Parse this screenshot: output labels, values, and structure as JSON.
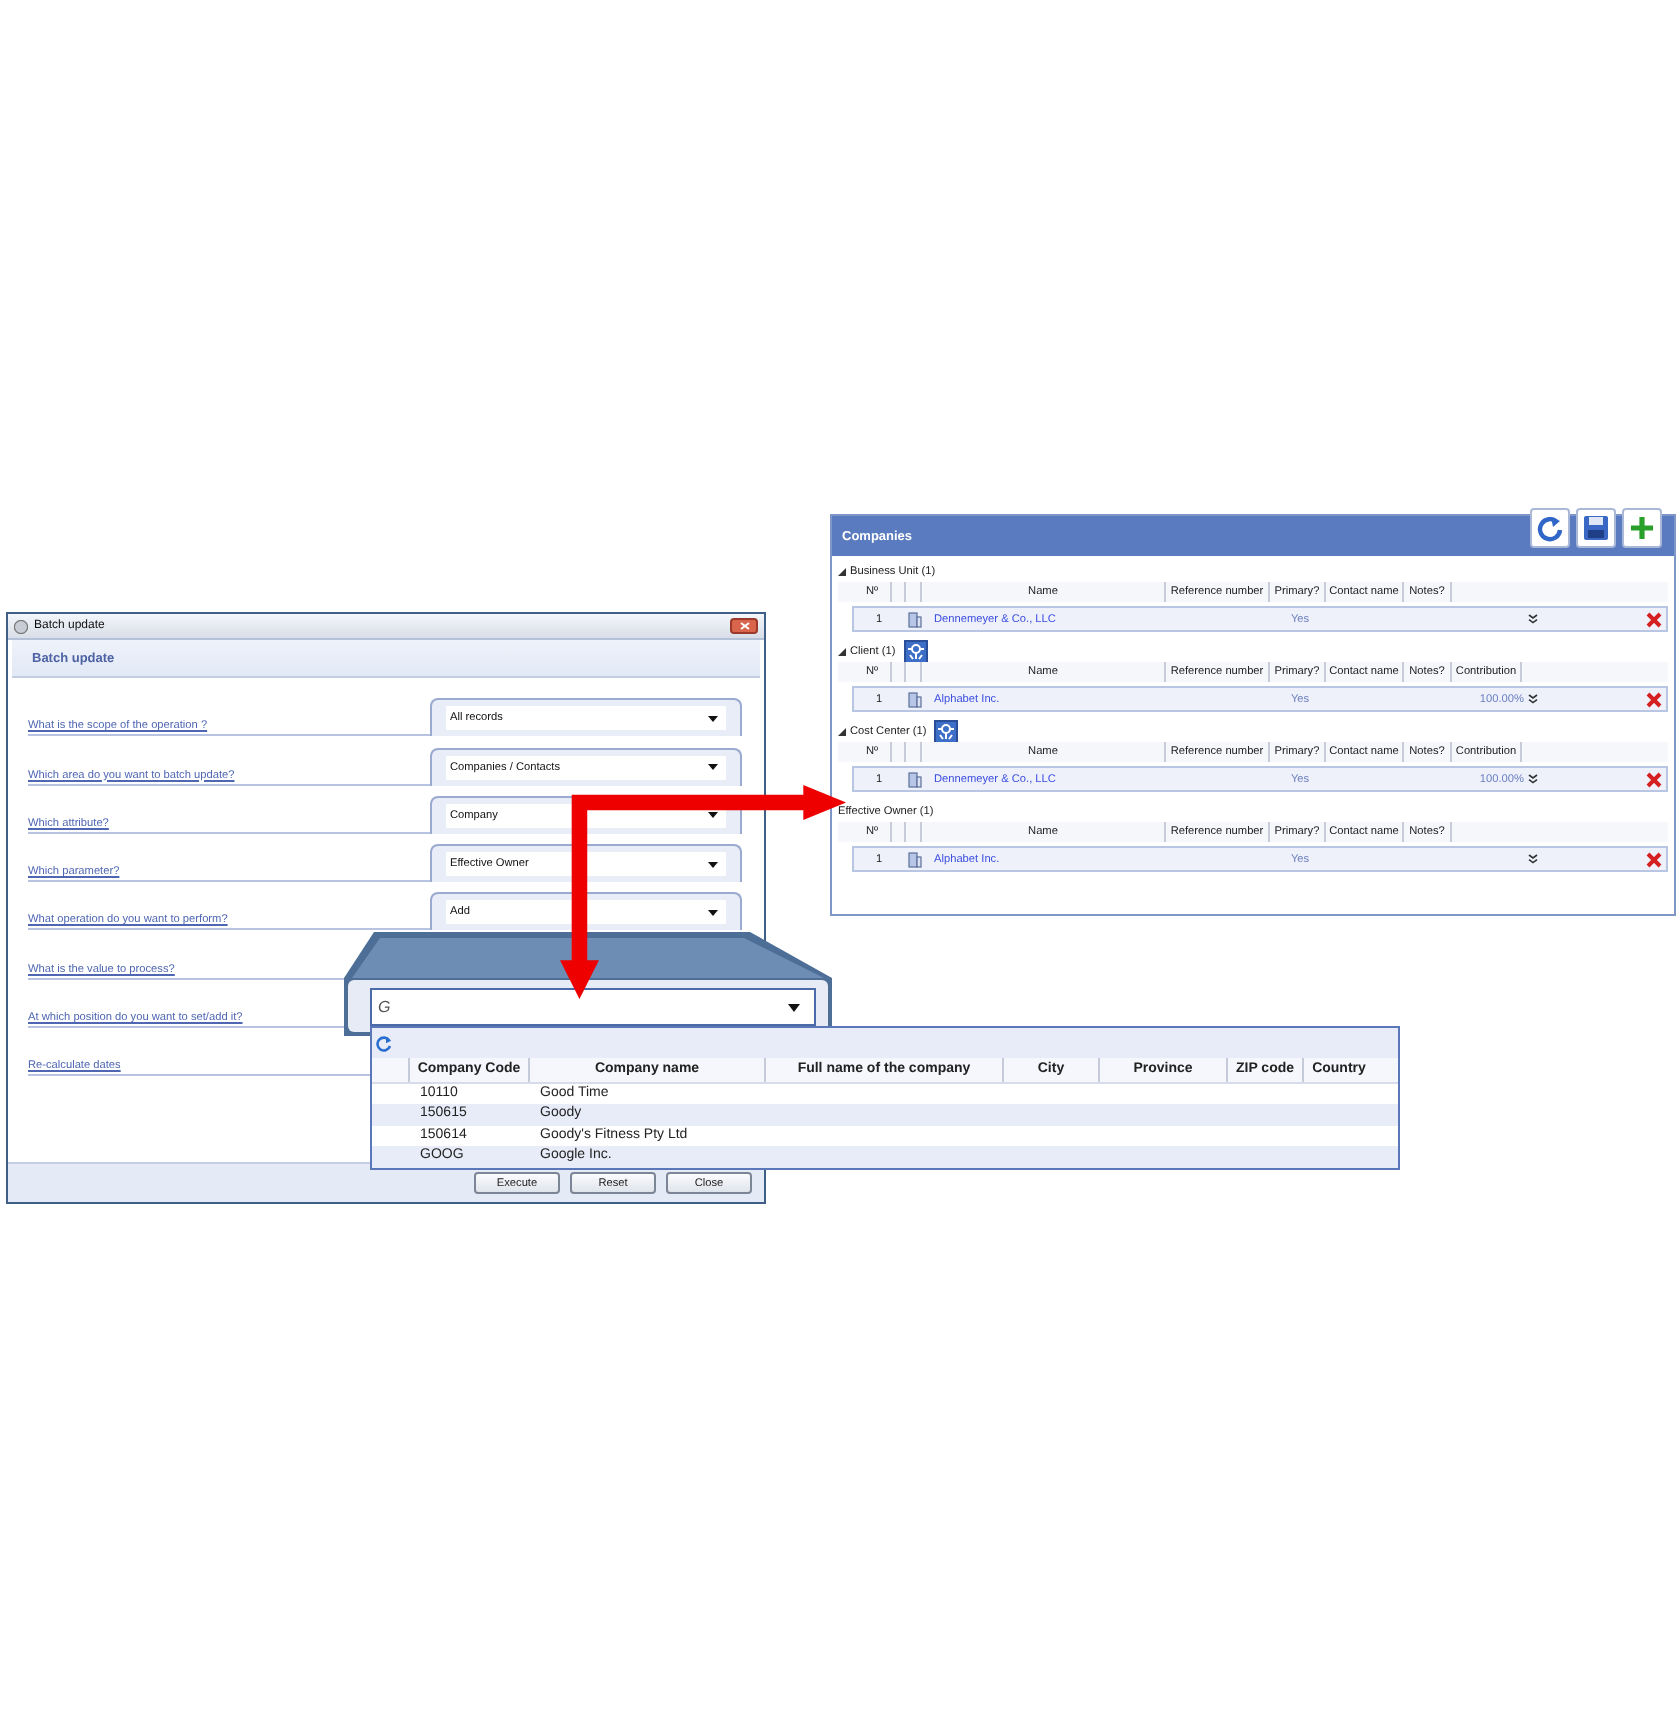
{
  "batch_dialog": {
    "title": "Batch update",
    "heading": "Batch update",
    "fields": [
      {
        "label": "What is the scope of the operation ?",
        "value": "All records"
      },
      {
        "label": "Which area do you want to batch update?",
        "value": "Companies / Contacts"
      },
      {
        "label": "Which attribute?",
        "value": "Company"
      },
      {
        "label": "Which parameter?",
        "value": "Effective Owner"
      },
      {
        "label": "What operation do you want to perform?",
        "value": "Add"
      },
      {
        "label": "What is the value to process?"
      },
      {
        "label": "At which position do you want to set/add it?"
      },
      {
        "label": "Re-calculate dates"
      }
    ],
    "buttons": [
      "Execute",
      "Reset",
      "Close"
    ]
  },
  "value_lookup": {
    "search": {
      "value": "G"
    },
    "columns": [
      "Company Code",
      "Company name",
      "Full name of the company",
      "City",
      "Province",
      "ZIP code",
      "Country"
    ],
    "rows": [
      [
        "10110",
        "Good Time"
      ],
      [
        "150615",
        "Goody"
      ],
      [
        "150614",
        "Goody's Fitness Pty Ltd"
      ],
      [
        "GOOG",
        "Google Inc."
      ]
    ]
  },
  "companies_panel": {
    "title": "Companies",
    "groups": [
      {
        "label": "Business Unit (1)",
        "expanded": true,
        "assign_button": false,
        "columns": [
          "Nº",
          "Name",
          "Reference number",
          "Primary?",
          "Contact name",
          "Notes?"
        ],
        "rows": [
          {
            "number": "1",
            "name": "Dennemeyer & Co., LLC",
            "primary": "Yes"
          }
        ]
      },
      {
        "label": "Client (1)",
        "expanded": true,
        "assign_button": true,
        "columns": [
          "Nº",
          "Name",
          "Reference number",
          "Primary?",
          "Contact name",
          "Notes?",
          "Contribution"
        ],
        "rows": [
          {
            "number": "1",
            "name": "Alphabet Inc.",
            "primary": "Yes",
            "contribution": "100.00%"
          }
        ]
      },
      {
        "label": "Cost Center (1)",
        "expanded": true,
        "assign_button": true,
        "columns": [
          "Nº",
          "Name",
          "Reference number",
          "Primary?",
          "Contact name",
          "Notes?",
          "Contribution"
        ],
        "rows": [
          {
            "number": "1",
            "name": "Dennemeyer & Co., LLC",
            "primary": "Yes",
            "contribution": "100.00%"
          }
        ]
      },
      {
        "label": "Effective Owner (1)",
        "assign_button": false,
        "columns": [
          "Nº",
          "Name",
          "Reference number",
          "Primary?",
          "Contact name",
          "Notes?"
        ],
        "rows": [
          {
            "number": "1",
            "name": "Alphabet Inc.",
            "primary": "Yes"
          }
        ]
      }
    ]
  }
}
